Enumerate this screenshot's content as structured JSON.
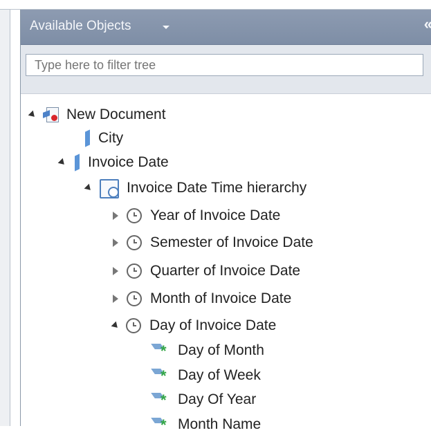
{
  "panel": {
    "title": "Available Objects",
    "collapse_glyph": "«"
  },
  "filter": {
    "placeholder": "Type here to filter tree"
  },
  "tree": {
    "root": "New Document",
    "city": "City",
    "invoice_date": "Invoice Date",
    "hierarchy": "Invoice Date Time hierarchy",
    "levels": [
      "Year of Invoice Date",
      "Semester of Invoice Date",
      "Quarter of Invoice Date",
      "Month of Invoice Date",
      "Day of Invoice Date"
    ],
    "day_items": [
      "Day of Month",
      "Day of Week",
      "Day Of Year",
      "Month Name"
    ]
  }
}
